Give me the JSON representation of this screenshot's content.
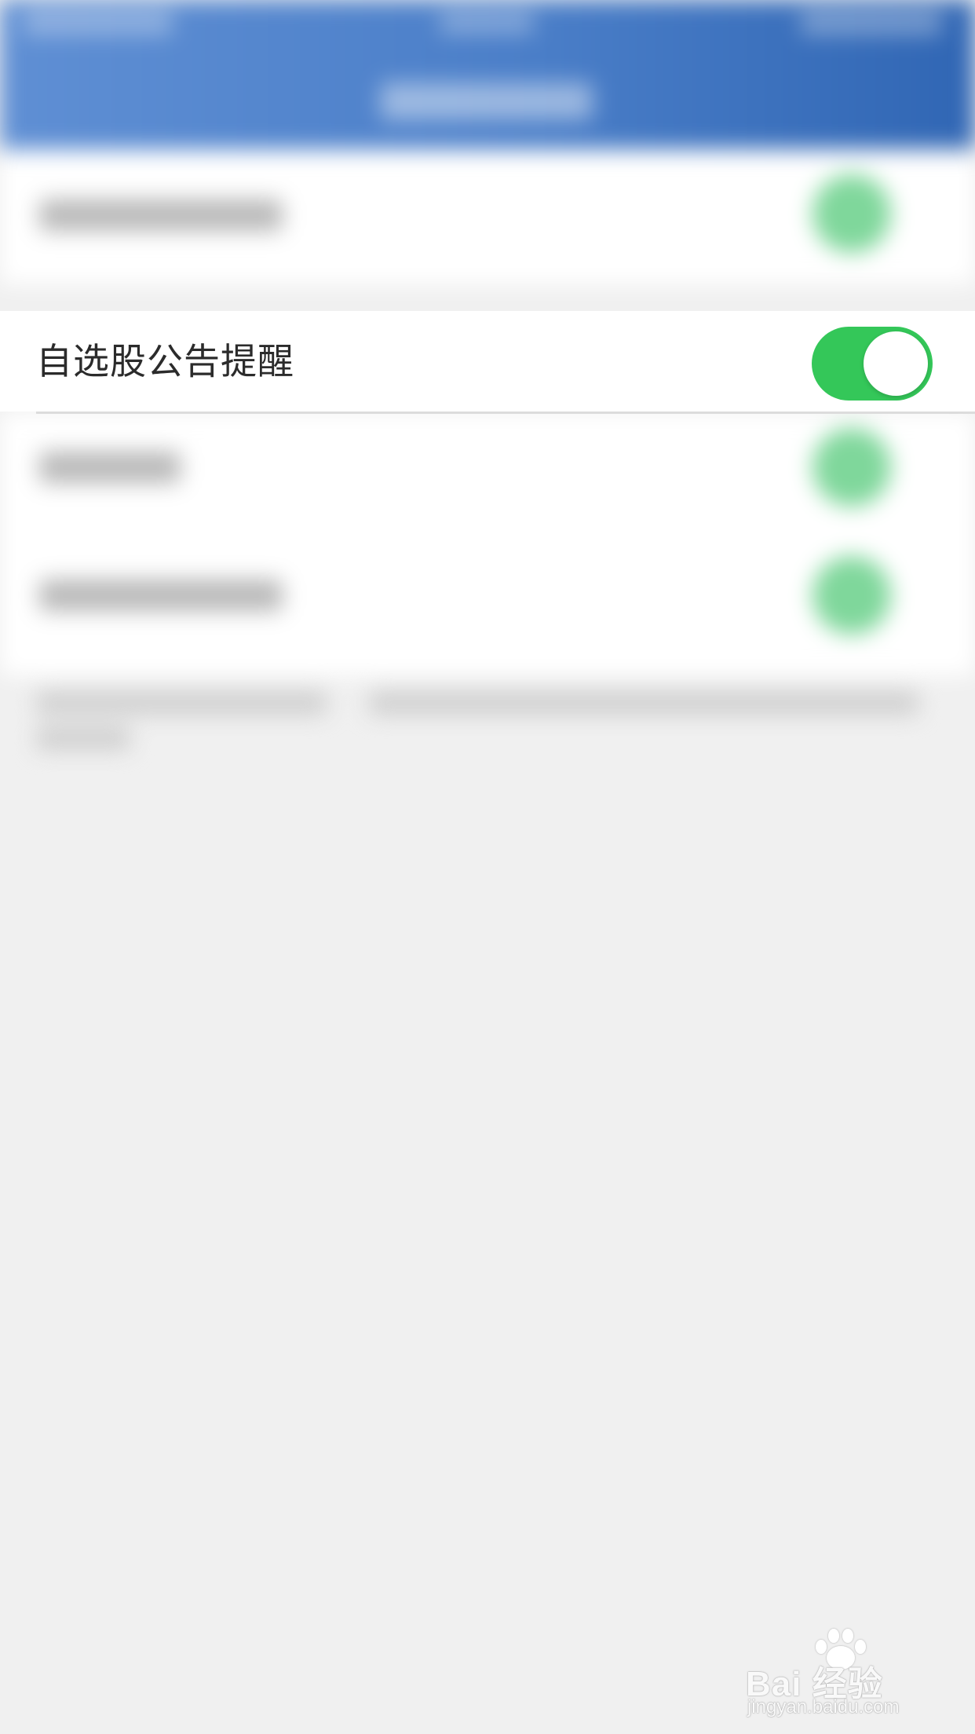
{
  "settings": {
    "focused_item": {
      "label": "自选股公告提醒",
      "toggle_on": true
    }
  },
  "colors": {
    "header_blue": "#4a7ec8",
    "toggle_green": "#34c759",
    "page_background": "#f0f0f0"
  },
  "watermark": {
    "brand": "Bai  经验",
    "url": "jingyan.baidu.com",
    "icon": "paw-icon"
  }
}
